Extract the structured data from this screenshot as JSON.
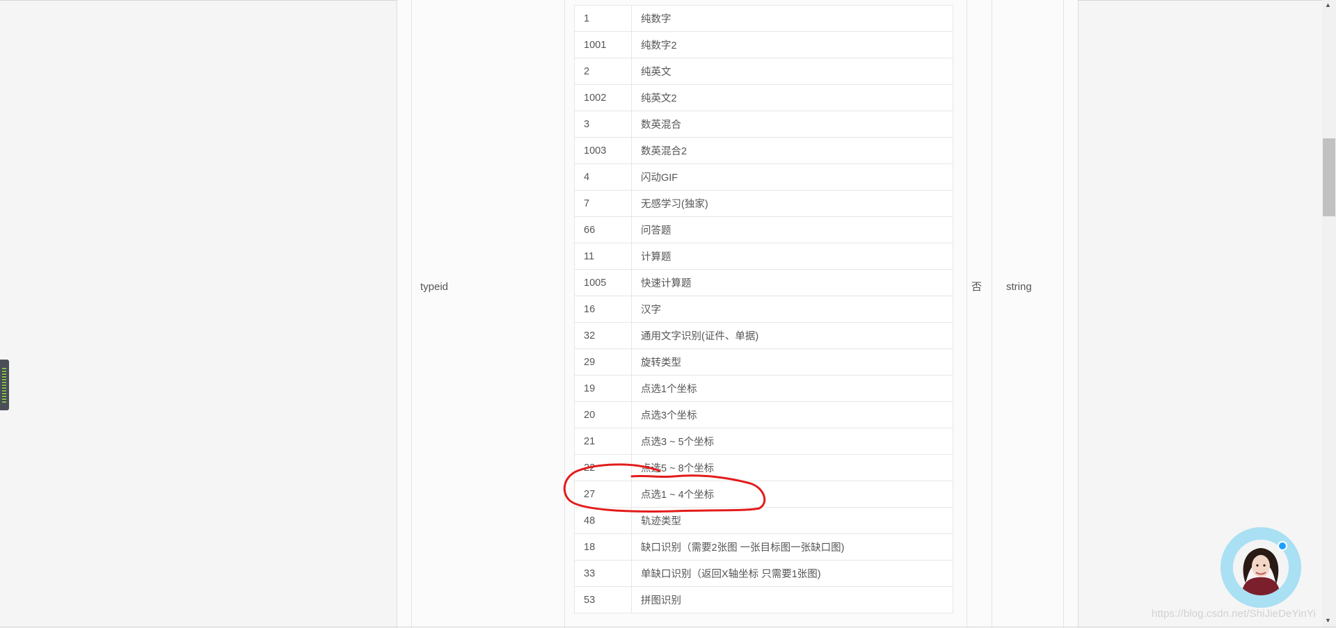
{
  "param": {
    "name": "typeid",
    "required": "否",
    "type": "string"
  },
  "typeid_values": [
    {
      "code": "1",
      "desc": "纯数字"
    },
    {
      "code": "1001",
      "desc": "纯数字2"
    },
    {
      "code": "2",
      "desc": "纯英文"
    },
    {
      "code": "1002",
      "desc": "纯英文2"
    },
    {
      "code": "3",
      "desc": "数英混合"
    },
    {
      "code": "1003",
      "desc": "数英混合2"
    },
    {
      "code": "4",
      "desc": "闪动GIF"
    },
    {
      "code": "7",
      "desc": "无感学习(独家)"
    },
    {
      "code": "66",
      "desc": "问答题"
    },
    {
      "code": "11",
      "desc": "计算题"
    },
    {
      "code": "1005",
      "desc": "快速计算题"
    },
    {
      "code": "16",
      "desc": "汉字"
    },
    {
      "code": "32",
      "desc": "通用文字识别(证件、单据)"
    },
    {
      "code": "29",
      "desc": "旋转类型"
    },
    {
      "code": "19",
      "desc": "点选1个坐标"
    },
    {
      "code": "20",
      "desc": "点选3个坐标"
    },
    {
      "code": "21",
      "desc": "点选3 ~ 5个坐标"
    },
    {
      "code": "22",
      "desc": "点选5 ~ 8个坐标"
    },
    {
      "code": "27",
      "desc": "点选1 ~ 4个坐标"
    },
    {
      "code": "48",
      "desc": "轨迹类型"
    },
    {
      "code": "18",
      "desc": "缺口识别（需要2张图 一张目标图一张缺口图)"
    },
    {
      "code": "33",
      "desc": "单缺口识别（返回X轴坐标 只需要1张图)"
    },
    {
      "code": "53",
      "desc": "拼图识别"
    }
  ],
  "highlighted_code": "27",
  "annotation": {
    "color": "#e31b1b"
  },
  "watermark": "https://blog.csdn.net/ShiJieDeYinYi"
}
